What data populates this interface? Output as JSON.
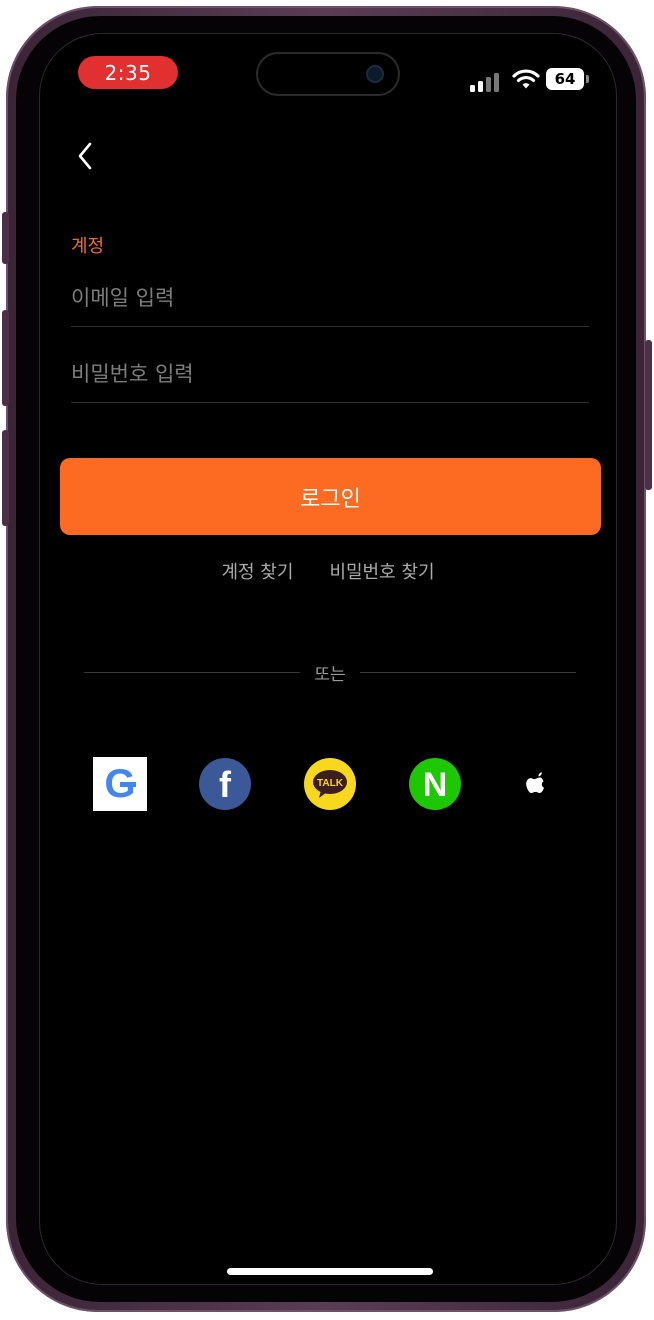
{
  "status_bar": {
    "time": "2:35",
    "battery": "64",
    "time_pill_color": "#e1302f"
  },
  "nav": {
    "back_icon": "chevron-left-icon"
  },
  "form": {
    "section_label": "계정",
    "email_placeholder": "이메일 입력",
    "password_placeholder": "비밀번호 입력",
    "login_label": "로그인",
    "accent_color": "#fd6b22"
  },
  "links": {
    "find_account": "계정 찾기",
    "find_password": "비밀번호 찾기"
  },
  "divider": {
    "label": "또는"
  },
  "social": {
    "google_logo": "G",
    "facebook_logo": "f",
    "kakao_logo": "TALK",
    "naver_logo": "N",
    "apple_logo": "apple-icon"
  }
}
